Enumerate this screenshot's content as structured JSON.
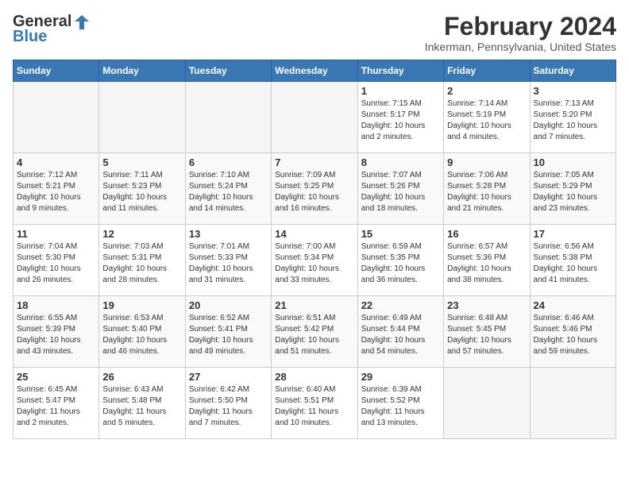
{
  "logo": {
    "general": "General",
    "blue": "Blue"
  },
  "title": "February 2024",
  "subtitle": "Inkerman, Pennsylvania, United States",
  "days_of_week": [
    "Sunday",
    "Monday",
    "Tuesday",
    "Wednesday",
    "Thursday",
    "Friday",
    "Saturday"
  ],
  "weeks": [
    [
      {
        "day": "",
        "info": ""
      },
      {
        "day": "",
        "info": ""
      },
      {
        "day": "",
        "info": ""
      },
      {
        "day": "",
        "info": ""
      },
      {
        "day": "1",
        "info": "Sunrise: 7:15 AM\nSunset: 5:17 PM\nDaylight: 10 hours\nand 2 minutes."
      },
      {
        "day": "2",
        "info": "Sunrise: 7:14 AM\nSunset: 5:19 PM\nDaylight: 10 hours\nand 4 minutes."
      },
      {
        "day": "3",
        "info": "Sunrise: 7:13 AM\nSunset: 5:20 PM\nDaylight: 10 hours\nand 7 minutes."
      }
    ],
    [
      {
        "day": "4",
        "info": "Sunrise: 7:12 AM\nSunset: 5:21 PM\nDaylight: 10 hours\nand 9 minutes."
      },
      {
        "day": "5",
        "info": "Sunrise: 7:11 AM\nSunset: 5:23 PM\nDaylight: 10 hours\nand 11 minutes."
      },
      {
        "day": "6",
        "info": "Sunrise: 7:10 AM\nSunset: 5:24 PM\nDaylight: 10 hours\nand 14 minutes."
      },
      {
        "day": "7",
        "info": "Sunrise: 7:09 AM\nSunset: 5:25 PM\nDaylight: 10 hours\nand 16 minutes."
      },
      {
        "day": "8",
        "info": "Sunrise: 7:07 AM\nSunset: 5:26 PM\nDaylight: 10 hours\nand 18 minutes."
      },
      {
        "day": "9",
        "info": "Sunrise: 7:06 AM\nSunset: 5:28 PM\nDaylight: 10 hours\nand 21 minutes."
      },
      {
        "day": "10",
        "info": "Sunrise: 7:05 AM\nSunset: 5:29 PM\nDaylight: 10 hours\nand 23 minutes."
      }
    ],
    [
      {
        "day": "11",
        "info": "Sunrise: 7:04 AM\nSunset: 5:30 PM\nDaylight: 10 hours\nand 26 minutes."
      },
      {
        "day": "12",
        "info": "Sunrise: 7:03 AM\nSunset: 5:31 PM\nDaylight: 10 hours\nand 28 minutes."
      },
      {
        "day": "13",
        "info": "Sunrise: 7:01 AM\nSunset: 5:33 PM\nDaylight: 10 hours\nand 31 minutes."
      },
      {
        "day": "14",
        "info": "Sunrise: 7:00 AM\nSunset: 5:34 PM\nDaylight: 10 hours\nand 33 minutes."
      },
      {
        "day": "15",
        "info": "Sunrise: 6:59 AM\nSunset: 5:35 PM\nDaylight: 10 hours\nand 36 minutes."
      },
      {
        "day": "16",
        "info": "Sunrise: 6:57 AM\nSunset: 5:36 PM\nDaylight: 10 hours\nand 38 minutes."
      },
      {
        "day": "17",
        "info": "Sunrise: 6:56 AM\nSunset: 5:38 PM\nDaylight: 10 hours\nand 41 minutes."
      }
    ],
    [
      {
        "day": "18",
        "info": "Sunrise: 6:55 AM\nSunset: 5:39 PM\nDaylight: 10 hours\nand 43 minutes."
      },
      {
        "day": "19",
        "info": "Sunrise: 6:53 AM\nSunset: 5:40 PM\nDaylight: 10 hours\nand 46 minutes."
      },
      {
        "day": "20",
        "info": "Sunrise: 6:52 AM\nSunset: 5:41 PM\nDaylight: 10 hours\nand 49 minutes."
      },
      {
        "day": "21",
        "info": "Sunrise: 6:51 AM\nSunset: 5:42 PM\nDaylight: 10 hours\nand 51 minutes."
      },
      {
        "day": "22",
        "info": "Sunrise: 6:49 AM\nSunset: 5:44 PM\nDaylight: 10 hours\nand 54 minutes."
      },
      {
        "day": "23",
        "info": "Sunrise: 6:48 AM\nSunset: 5:45 PM\nDaylight: 10 hours\nand 57 minutes."
      },
      {
        "day": "24",
        "info": "Sunrise: 6:46 AM\nSunset: 5:46 PM\nDaylight: 10 hours\nand 59 minutes."
      }
    ],
    [
      {
        "day": "25",
        "info": "Sunrise: 6:45 AM\nSunset: 5:47 PM\nDaylight: 11 hours\nand 2 minutes."
      },
      {
        "day": "26",
        "info": "Sunrise: 6:43 AM\nSunset: 5:48 PM\nDaylight: 11 hours\nand 5 minutes."
      },
      {
        "day": "27",
        "info": "Sunrise: 6:42 AM\nSunset: 5:50 PM\nDaylight: 11 hours\nand 7 minutes."
      },
      {
        "day": "28",
        "info": "Sunrise: 6:40 AM\nSunset: 5:51 PM\nDaylight: 11 hours\nand 10 minutes."
      },
      {
        "day": "29",
        "info": "Sunrise: 6:39 AM\nSunset: 5:52 PM\nDaylight: 11 hours\nand 13 minutes."
      },
      {
        "day": "",
        "info": ""
      },
      {
        "day": "",
        "info": ""
      }
    ]
  ]
}
